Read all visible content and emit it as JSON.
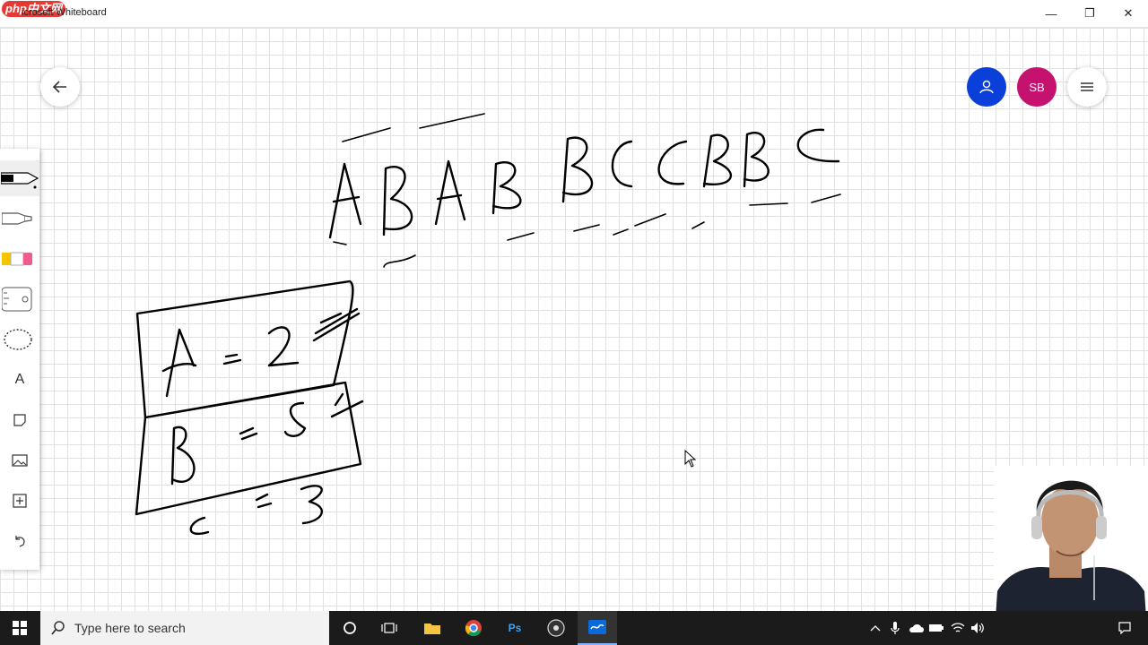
{
  "window": {
    "watermark": "php中文网",
    "title": "icrosoft Whiteboard",
    "minimize_glyph": "—",
    "restore_glyph": "❐",
    "close_glyph": "✕"
  },
  "header": {
    "user_initials": "SB",
    "user_color": "#c5126e",
    "invite_color": "#0b3fd9"
  },
  "toolbar": {
    "tools": [
      "pen",
      "highlighter",
      "eraser",
      "ruler",
      "lasso",
      "text",
      "note",
      "image",
      "insert",
      "undo"
    ],
    "text_tool_glyph": "A",
    "selected": "pen"
  },
  "taskbar": {
    "search_placeholder": "Type here to search",
    "ps_label": "Ps",
    "active_app": "whiteboard"
  }
}
